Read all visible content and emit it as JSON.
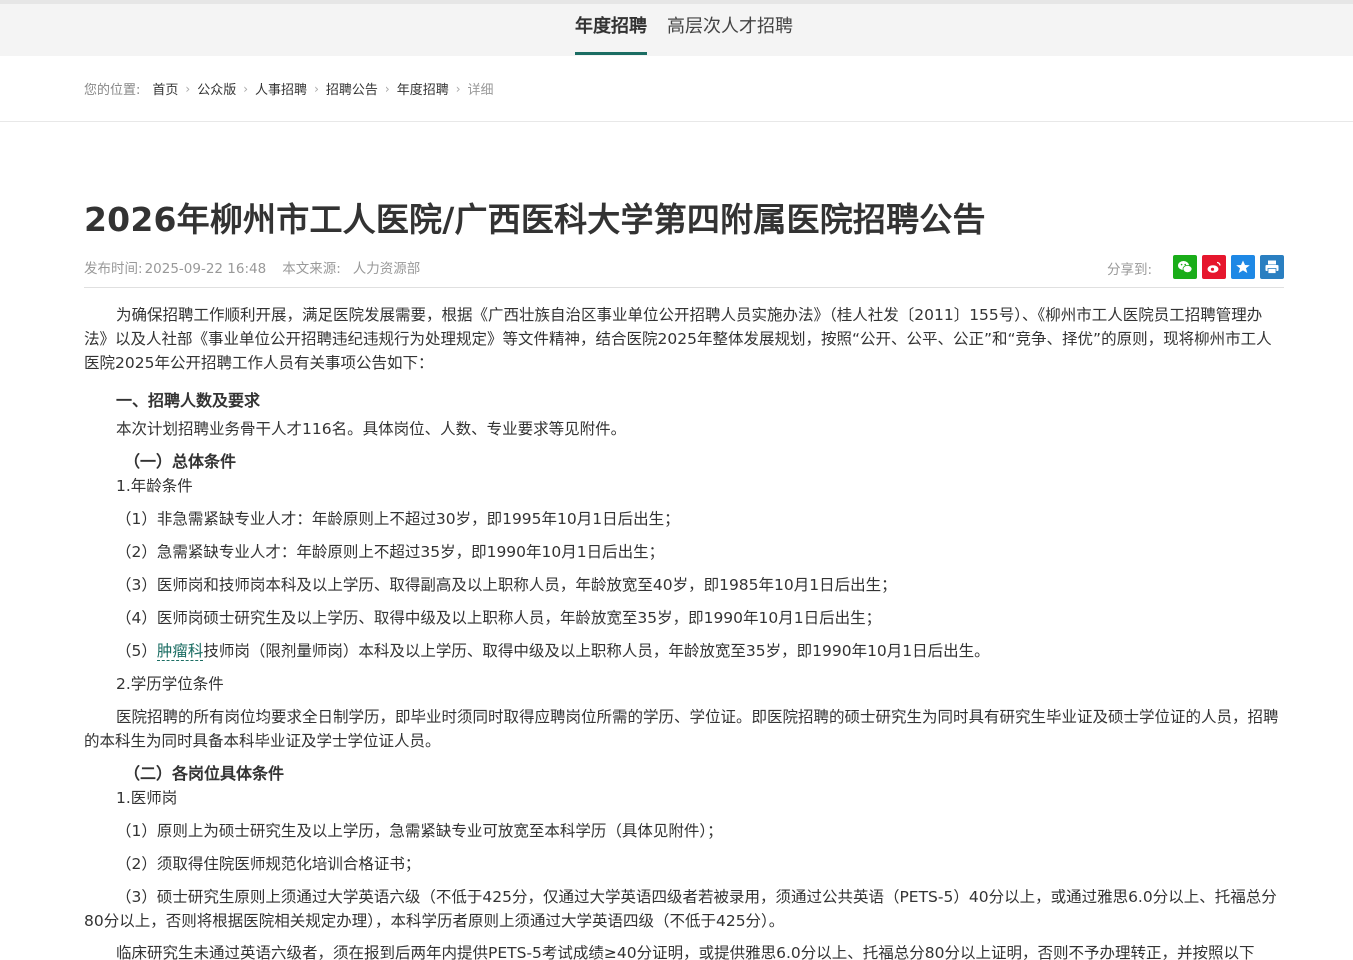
{
  "nav": {
    "tabs": [
      {
        "label": "年度招聘",
        "active": true
      },
      {
        "label": "高层次人才招聘",
        "active": false
      }
    ]
  },
  "breadcrumb": {
    "label": "您的位置:",
    "items": [
      "首页",
      "公众版",
      "人事招聘",
      "招聘公告",
      "年度招聘"
    ],
    "current": "详细"
  },
  "article": {
    "title": "2026年柳州市工人医院/广西医科大学第四附属医院招聘公告",
    "publish_label": "发布时间:",
    "publish_time": "2025-09-22 16:48",
    "source_label": "本文来源:",
    "source": "人力资源部",
    "share_label": "分享到:",
    "share_icons": [
      "wechat-icon",
      "weibo-icon",
      "favorite-star-icon",
      "print-icon"
    ],
    "colors": {
      "accent": "#1b6d63",
      "wechat": "#1aad19",
      "weibo": "#e6162d",
      "favorite": "#1e88e5",
      "print": "#2a7fc1"
    },
    "intro": "为确保招聘工作顺利开展，满足医院发展需要，根据《广西壮族自治区事业单位公开招聘人员实施办法》（桂人社发〔2011〕155号）、《柳州市工人医院员工招聘管理办法》以及人社部《事业单位公开招聘违纪违规行为处理规定》等文件精神，结合医院2025年整体发展规划，按照“公开、公平、公正”和“竞争、择优”的原则，现将柳州市工人医院2025年公开招聘工作人员有关事项公告如下：",
    "section1_title": "一、招聘人数及要求",
    "section1_text": "本次计划招聘业务骨干人才116名。具体岗位、人数、专业要求等见附件。",
    "sub1_title": "（一）总体条件",
    "age_title": "1.年龄条件",
    "age_items": [
      "（1）非急需紧缺专业人才：年龄原则上不超过30岁，即1995年10月1日后出生；",
      "（2）急需紧缺专业人才：年龄原则上不超过35岁，即1990年10月1日后出生；",
      "（3）医师岗和技师岗本科及以上学历、取得副高及以上职称人员，年龄放宽至40岁，即1985年10月1日后出生；",
      "（4）医师岗硕士研究生及以上学历、取得中级及以上职称人员，年龄放宽至35岁，即1990年10月1日后出生；"
    ],
    "age_item5_prefix": "（5）",
    "age_item5_term": "肿瘤科",
    "age_item5_rest": "技师岗（限剂量师岗）本科及以上学历、取得中级及以上职称人员，年龄放宽至35岁，即1990年10月1日后出生。",
    "edu_title": "2.学历学位条件",
    "edu_text": "医院招聘的所有岗位均要求全日制学历，即毕业时须同时取得应聘岗位所需的学历、学位证。即医院招聘的硕士研究生为同时具有研究生毕业证及硕士学位证的人员，招聘的本科生为同时具备本科毕业证及学士学位证人员。",
    "sub2_title": "（二）各岗位具体条件",
    "doc_title": "1.医师岗",
    "doc_items": [
      "（1）原则上为硕士研究生及以上学历，急需紧缺专业可放宽至本科学历（具体见附件）；",
      "（2）须取得住院医师规范化培训合格证书；",
      "（3）硕士研究生原则上须通过大学英语六级（不低于425分，仅通过大学英语四级者若被录用，须通过公共英语（PETS-5）40分以上，或通过雅思6.0分以上、托福总分80分以上，否则将根据医院相关规定办理），本科学历者原则上须通过大学英语四级（不低于425分）。"
    ],
    "clinical_text": "临床研究生未通过英语六级者，须在报到后两年内提供PETS-5考试成绩≥40分证明，或提供雅思6.0分以上、托福总分80分以上证明，否则不予办理转正，并按照以下"
  }
}
